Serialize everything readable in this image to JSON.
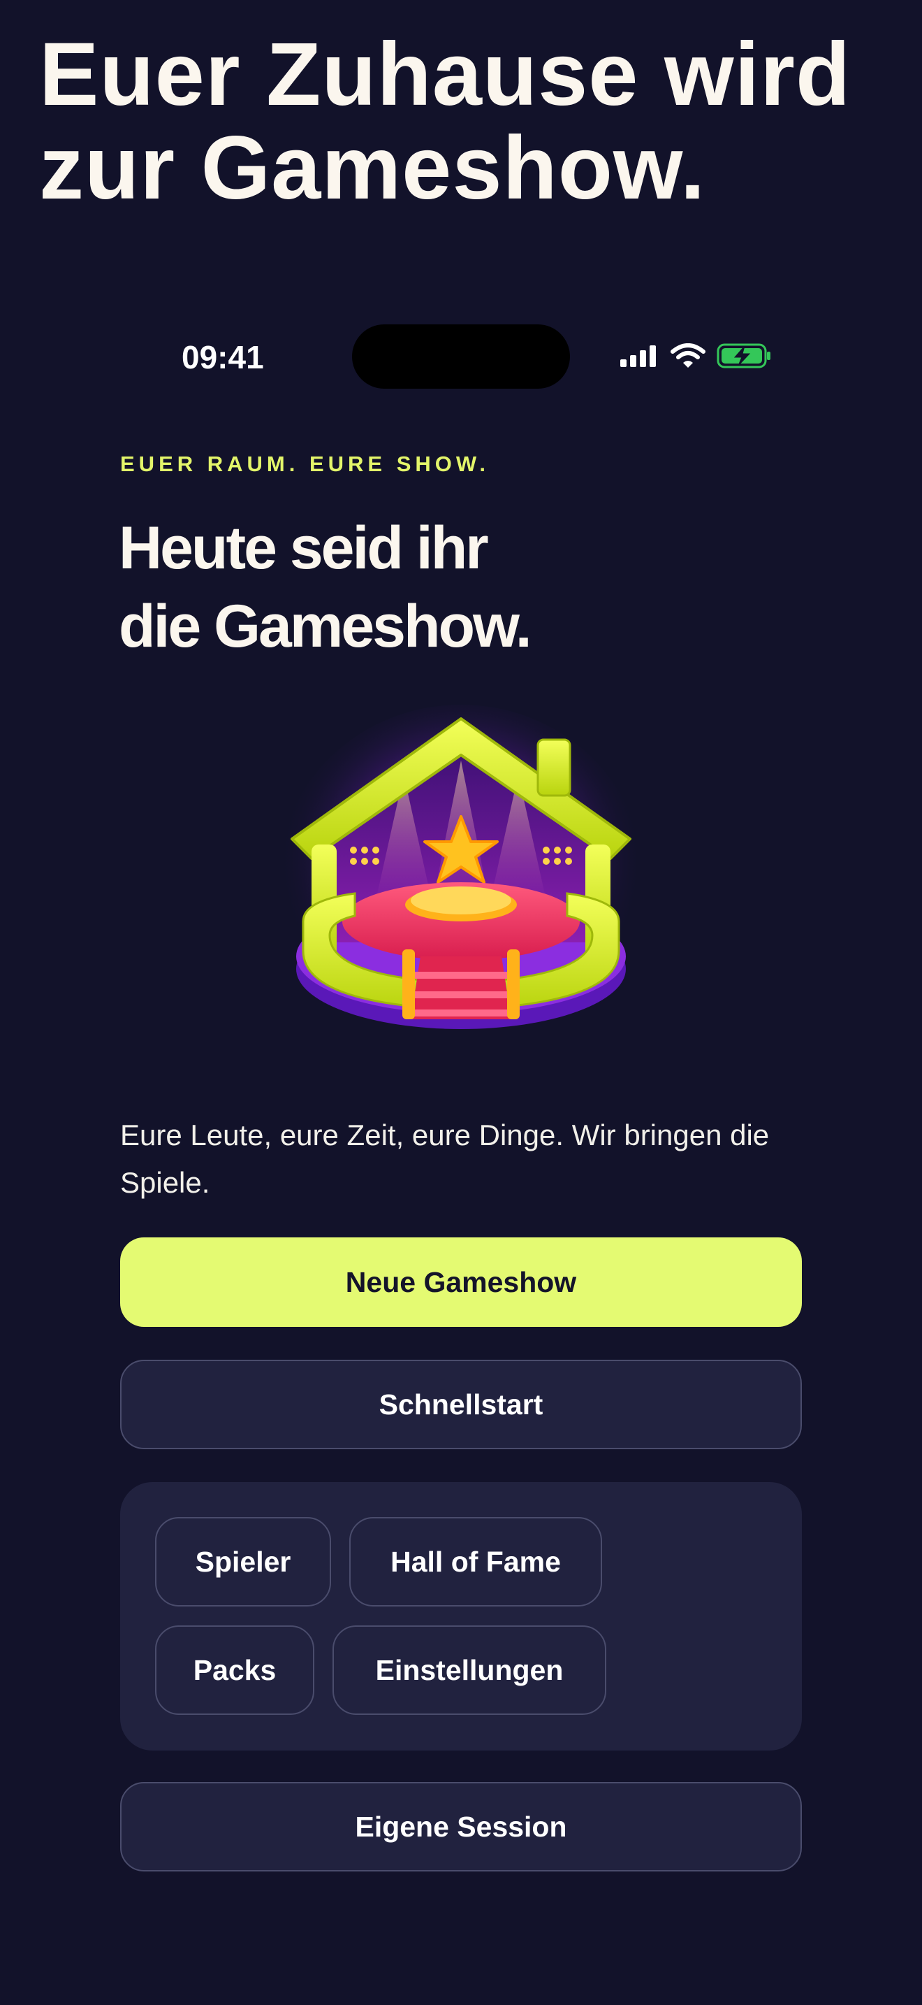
{
  "headline": {
    "line1": "Euer Zuhause wird",
    "line2": "zur Gameshow."
  },
  "status_bar": {
    "time": "09:41",
    "signal_icon": "cellular-signal-icon",
    "wifi_icon": "wifi-icon",
    "battery_icon": "battery-charging-icon",
    "battery_color": "#34c759"
  },
  "hero": {
    "eyebrow": "EUER RAUM. EURE SHOW.",
    "title_line1": "Heute seid ihr",
    "title_line2": "die Gameshow.",
    "image_icon": "gameshow-house-stage-illustration",
    "tagline": "Eure Leute, eure Zeit, eure Dinge. Wir bringen die Spiele."
  },
  "actions": {
    "primary_label": "Neue Gameshow",
    "quick_start_label": "Schnellstart",
    "custom_session_label": "Eigene Session"
  },
  "shortcuts": [
    {
      "label": "Spieler"
    },
    {
      "label": "Hall of Fame"
    },
    {
      "label": "Packs"
    },
    {
      "label": "Einstellungen"
    }
  ],
  "colors": {
    "background": "#12122a",
    "accent": "#e4fa72",
    "surface": "#21223f",
    "border": "#4a4c6c",
    "text": "#fbf6ee"
  }
}
